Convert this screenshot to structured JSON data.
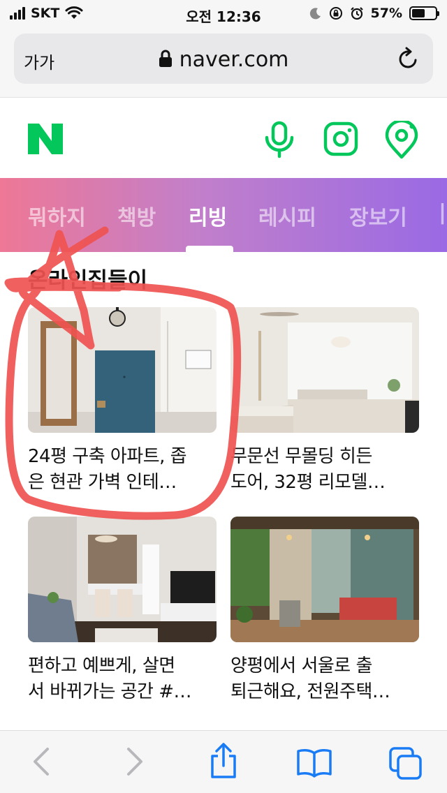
{
  "status_bar": {
    "carrier": "SKT",
    "time": "오전 12:36",
    "battery_percent": "57%",
    "battery_level": 0.57
  },
  "browser": {
    "text_size_label": "가가",
    "url": "naver.com",
    "icons": [
      "lock-icon",
      "reload-icon"
    ]
  },
  "header": {
    "icons": [
      "naver-logo",
      "microphone-icon",
      "lens-camera-icon",
      "location-icon"
    ]
  },
  "tabs": [
    {
      "label": "뭐하지",
      "active": false
    },
    {
      "label": "책방",
      "active": false
    },
    {
      "label": "리빙",
      "active": true
    },
    {
      "label": "레시피",
      "active": false
    },
    {
      "label": "장보기",
      "active": false
    }
  ],
  "section": {
    "title": "온라인집들이"
  },
  "cards": [
    {
      "caption_line1": "24평 구축 아파트, 좁",
      "caption_line2": "은 현관 가벽 인테…"
    },
    {
      "caption_line1": "무문선 무몰딩 히든",
      "caption_line2": "도어, 32평 리모델…"
    },
    {
      "caption_line1": "편하고 예쁘게, 살면",
      "caption_line2": "서 바뀌가는 공간 #…"
    },
    {
      "caption_line1": "양평에서 서울로 출",
      "caption_line2": "퇴근해요, 전원주택…"
    }
  ],
  "toolbar": {
    "icons": [
      "back-icon",
      "forward-icon",
      "share-icon",
      "bookmarks-icon",
      "tabs-icon"
    ]
  },
  "colors": {
    "naver_green": "#03c75a",
    "tab_gradient_start": "#ee7896",
    "tab_gradient_end": "#9a6ae4",
    "scribble": "#ef5350",
    "ios_blue": "#1a7cf5"
  }
}
